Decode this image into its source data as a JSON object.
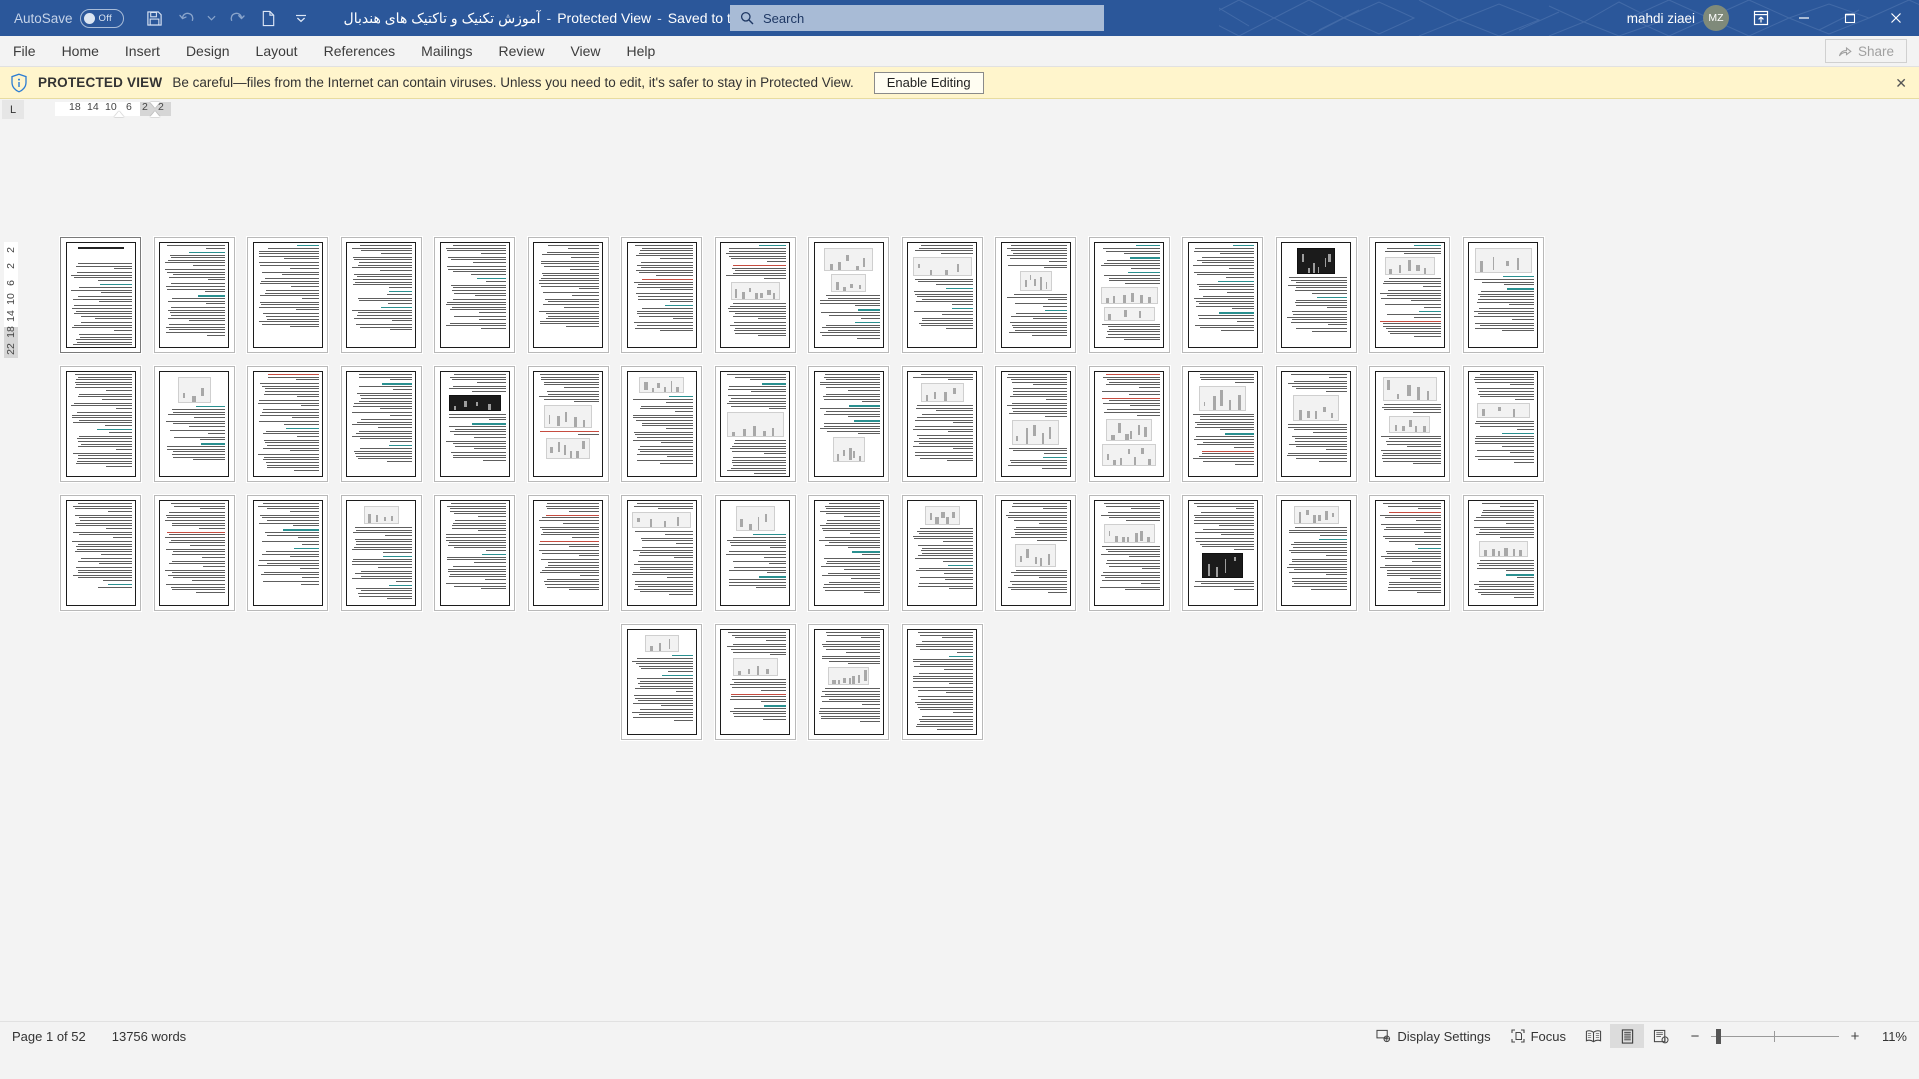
{
  "titlebar": {
    "autosave_label": "AutoSave",
    "autosave_state": "Off",
    "doc_title": "آموزش تکنیک و تاکتیک های هندبال",
    "sep1": "-",
    "protected_view": "Protected View",
    "sep2": "-",
    "saved_state": "Saved to this PC",
    "caret": "▾",
    "qat": [
      {
        "name": "save-icon",
        "tip": "Save"
      },
      {
        "name": "undo-icon",
        "tip": "Undo"
      },
      {
        "name": "undo-dropdown-icon",
        "tip": "Undo options"
      },
      {
        "name": "redo-icon",
        "tip": "Redo"
      },
      {
        "name": "new-document-icon",
        "tip": "New"
      },
      {
        "name": "customize-quick-access-toolbar-icon",
        "tip": "Customize Quick Access Toolbar"
      }
    ],
    "user_name": "mahdi ziaei",
    "user_initials": "MZ",
    "ribbon_display_icon": "ribbon-display-options-icon",
    "minimize": "−",
    "restore": "❐",
    "close": "✕"
  },
  "search": {
    "placeholder": "Search",
    "icon": "search-icon"
  },
  "ribbon": {
    "tabs": [
      {
        "label": "File"
      },
      {
        "label": "Home"
      },
      {
        "label": "Insert"
      },
      {
        "label": "Design"
      },
      {
        "label": "Layout"
      },
      {
        "label": "References"
      },
      {
        "label": "Mailings"
      },
      {
        "label": "Review"
      },
      {
        "label": "View"
      },
      {
        "label": "Help"
      }
    ],
    "share_label": "Share",
    "share_icon": "share-icon"
  },
  "protected_view": {
    "icon": "shield-info-icon",
    "strong": "PROTECTED VIEW",
    "message": "Be careful—files from the Internet can contain viruses. Unless you need to edit, it's safer to stay in Protected View.",
    "enable_label": "Enable Editing",
    "close_icon": "close-icon",
    "close_glyph": "✕",
    "bg_color": "#fff5cc"
  },
  "ruler": {
    "tab_stop_glyph": "L",
    "horizontal_numbers": [
      "18",
      "14",
      "10",
      "6",
      "2",
      "2"
    ],
    "vertical_numbers": [
      "2",
      "2",
      "6",
      "10",
      "14",
      "18",
      "22"
    ]
  },
  "statusbar": {
    "page_indicator": "Page 1 of 52",
    "word_count": "13756 words",
    "display_settings": "Display Settings",
    "display_settings_icon": "display-settings-icon",
    "focus": "Focus",
    "focus_icon": "focus-icon",
    "views": [
      {
        "name": "read-mode-icon",
        "active": false
      },
      {
        "name": "print-layout-icon",
        "active": true
      },
      {
        "name": "web-layout-icon",
        "active": false
      }
    ],
    "zoom_out": "−",
    "zoom_in": "+",
    "zoom_level": "11%"
  },
  "document": {
    "language": "fa",
    "direction": "rtl",
    "total_pages": 52,
    "accent_heading_color": "#1f8a8a",
    "accent_alert_color": "#c0392b",
    "pages_visible": 52,
    "rows": [
      16,
      16,
      16,
      4
    ]
  }
}
